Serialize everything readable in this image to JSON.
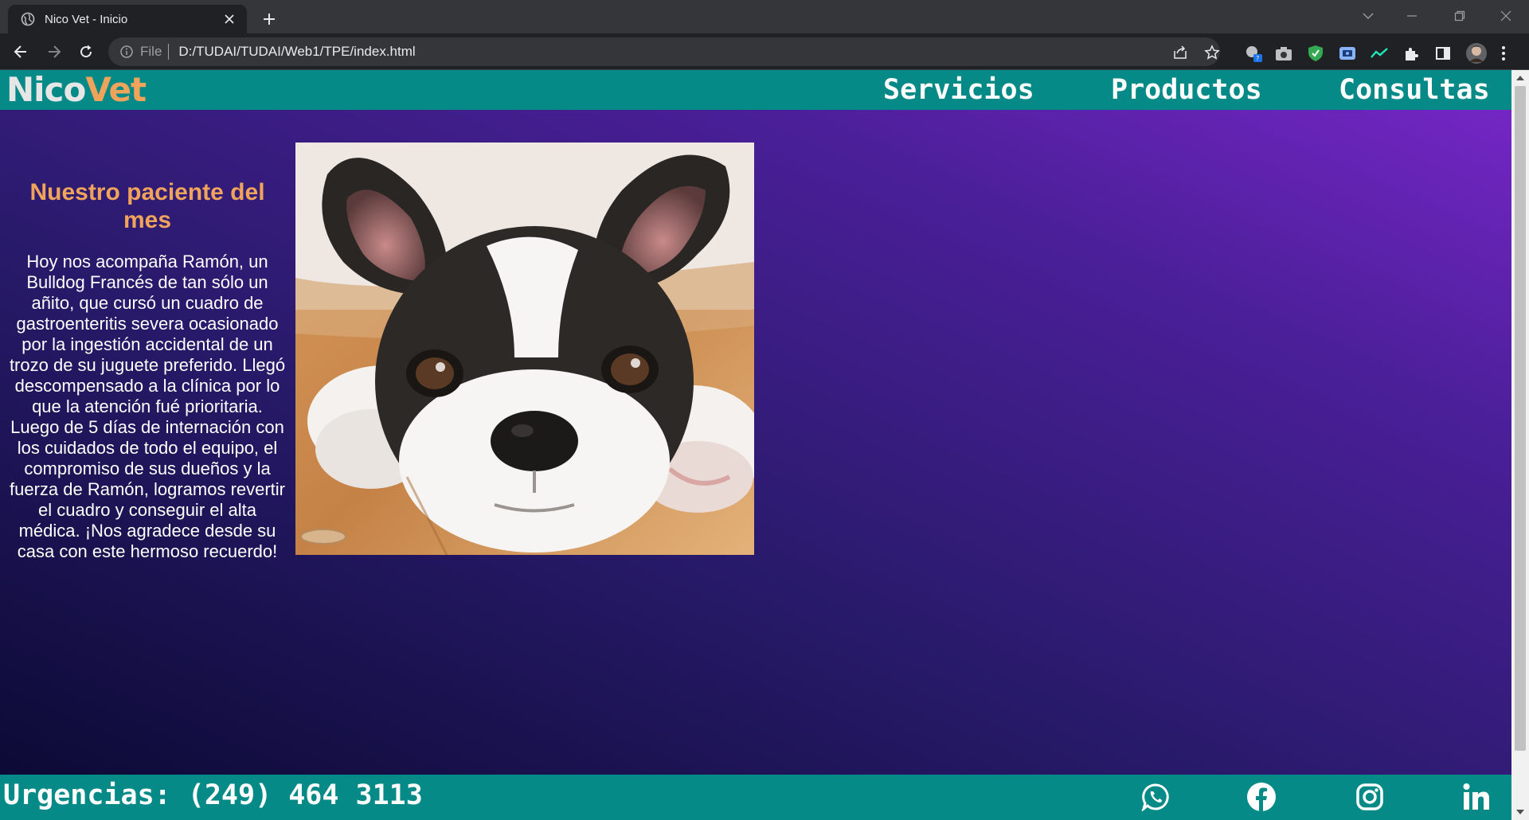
{
  "browser": {
    "tab_title": "Nico Vet - Inicio",
    "omnibox_scheme": "File",
    "omnibox_url": "D:/TUDAI/TUDAI/Web1/TPE/index.html"
  },
  "site": {
    "logo_part1": "Nico",
    "logo_part2": "Vet",
    "nav": [
      "Servicios",
      "Productos",
      "Consultas"
    ],
    "featured": {
      "title": "Nuestro paciente del mes",
      "text": "Hoy nos acompaña Ramón, un Bulldog Francés de tan sólo un añito, que cursó un cuadro de gastroenteritis severa ocasionado por la ingestión accidental de un trozo de su juguete preferido. Llegó descompensado a la clínica por lo que la atención fué prioritaria. Luego de 5 días de internación con los cuidados de todo el equipo, el compromiso de sus dueños y la fuerza de Ramón, logramos revertir el cuadro y conseguir el alta médica. ¡Nos agradece desde su casa con este hermoso recuerdo!",
      "image_subject": "french-bulldog-puppy"
    },
    "footer": {
      "urgencias": "Urgencias: (249) 464 3113",
      "social_icons": [
        "whatsapp-icon",
        "facebook-icon",
        "instagram-icon",
        "linkedin-icon"
      ]
    }
  },
  "colors": {
    "header_teal": "#058a87",
    "logo_light": "#e6e6e6",
    "logo_accent": "#f0a35a",
    "gradient_dark": "#0c0a35",
    "gradient_light": "#7426c4"
  }
}
